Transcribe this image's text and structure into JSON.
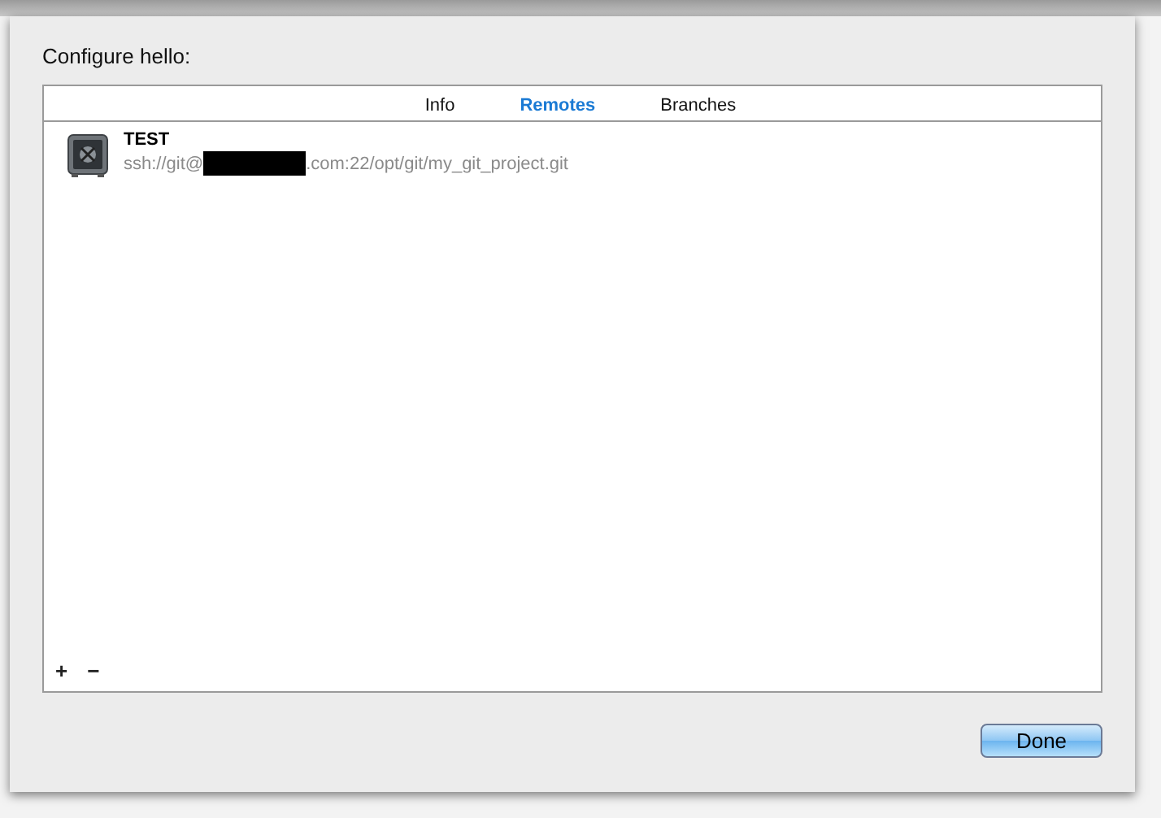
{
  "sheet": {
    "title": "Configure hello:"
  },
  "tabs": [
    {
      "label": "Info",
      "selected": false
    },
    {
      "label": "Remotes",
      "selected": true
    },
    {
      "label": "Branches",
      "selected": false
    }
  ],
  "remotes": [
    {
      "name": "TEST",
      "url_start": "ssh://git@",
      "redacted": true,
      "url_end": ".com:22/opt/git/my_git_project.git"
    }
  ],
  "list_buttons": [
    "+",
    "−"
  ],
  "buttons": [
    {
      "label": "Done",
      "default": true
    }
  ]
}
